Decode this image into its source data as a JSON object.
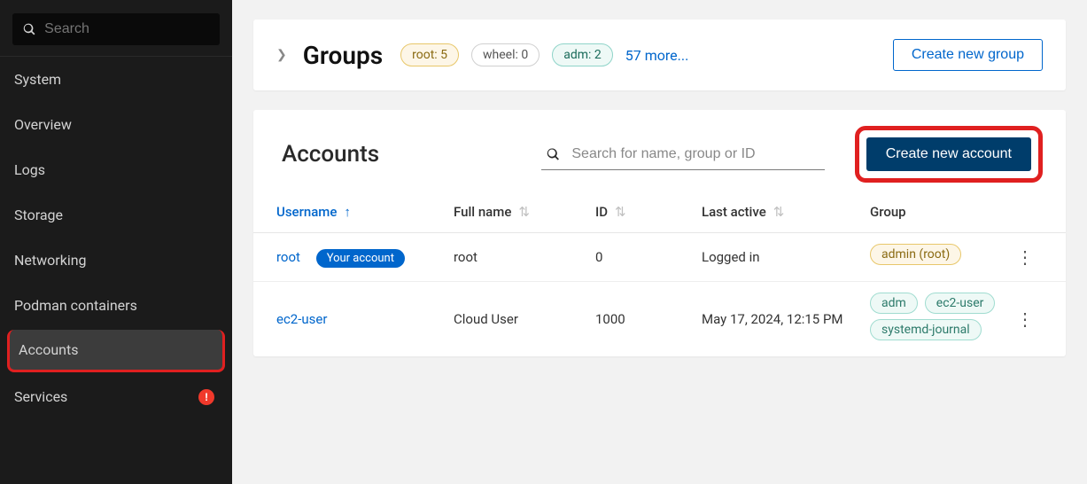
{
  "sidebar": {
    "search_placeholder": "Search",
    "items": [
      {
        "label": "System"
      },
      {
        "label": "Overview"
      },
      {
        "label": "Logs"
      },
      {
        "label": "Storage"
      },
      {
        "label": "Networking"
      },
      {
        "label": "Podman containers"
      },
      {
        "label": "Accounts"
      },
      {
        "label": "Services"
      }
    ]
  },
  "groups": {
    "title": "Groups",
    "chips": [
      {
        "text": "root: 5",
        "style": "root"
      },
      {
        "text": "wheel: 0",
        "style": "wheel"
      },
      {
        "text": "adm: 2",
        "style": "adm"
      }
    ],
    "more_link": "57 more...",
    "create_button": "Create new group"
  },
  "accounts": {
    "title": "Accounts",
    "search_placeholder": "Search for name, group or ID",
    "create_button": "Create new account",
    "columns": {
      "username": "Username",
      "fullname": "Full name",
      "id": "ID",
      "last_active": "Last active",
      "group": "Group"
    },
    "rows": [
      {
        "username": "root",
        "your_account": "Your account",
        "fullname": "root",
        "id": "0",
        "last_active": "Logged in",
        "groups": [
          {
            "text": "admin (root)",
            "style": "admin"
          }
        ]
      },
      {
        "username": "ec2-user",
        "fullname": "Cloud User",
        "id": "1000",
        "last_active": "May 17, 2024, 12:15 PM",
        "groups": [
          {
            "text": "adm",
            "style": ""
          },
          {
            "text": "ec2-user",
            "style": ""
          },
          {
            "text": "systemd-journal",
            "style": ""
          }
        ]
      }
    ]
  }
}
